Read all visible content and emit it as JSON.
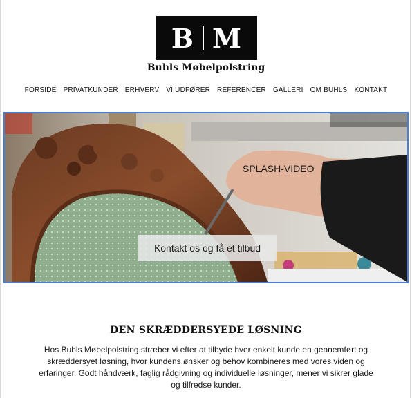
{
  "brand": {
    "logo_left": "B",
    "logo_right": "M",
    "name": "Buhls Møbelpolstring"
  },
  "nav": {
    "items": [
      {
        "label": "FORSIDE"
      },
      {
        "label": "PRIVATKUNDER"
      },
      {
        "label": "ERHVERV"
      },
      {
        "label": "VI UDFØRER"
      },
      {
        "label": "REFERENCER"
      },
      {
        "label": "GALLERI"
      },
      {
        "label": "OM BUHLS"
      },
      {
        "label": "KONTAKT"
      }
    ]
  },
  "hero": {
    "video_label": "SPLASH-VIDEO",
    "cta_label": "Kontakt os og få et tilbud"
  },
  "section": {
    "title": "DEN SKRÆDDERSYEDE LØSNING",
    "body": "Hos Buhls Møbelpolstring stræber vi efter at tilbyde hver enkelt kunde en gennemført og skræddersyet løsning, hvor kundens ønsker og behov kombineres med vores viden og erfaringer. Godt håndværk, faglig rådgivning og individuelle løsninger, mener vi sikrer glade og tilfredse kunder."
  },
  "colors": {
    "logo_bg": "#0a0a0a",
    "hero_border": "#4a7fd0",
    "text": "#111111"
  }
}
